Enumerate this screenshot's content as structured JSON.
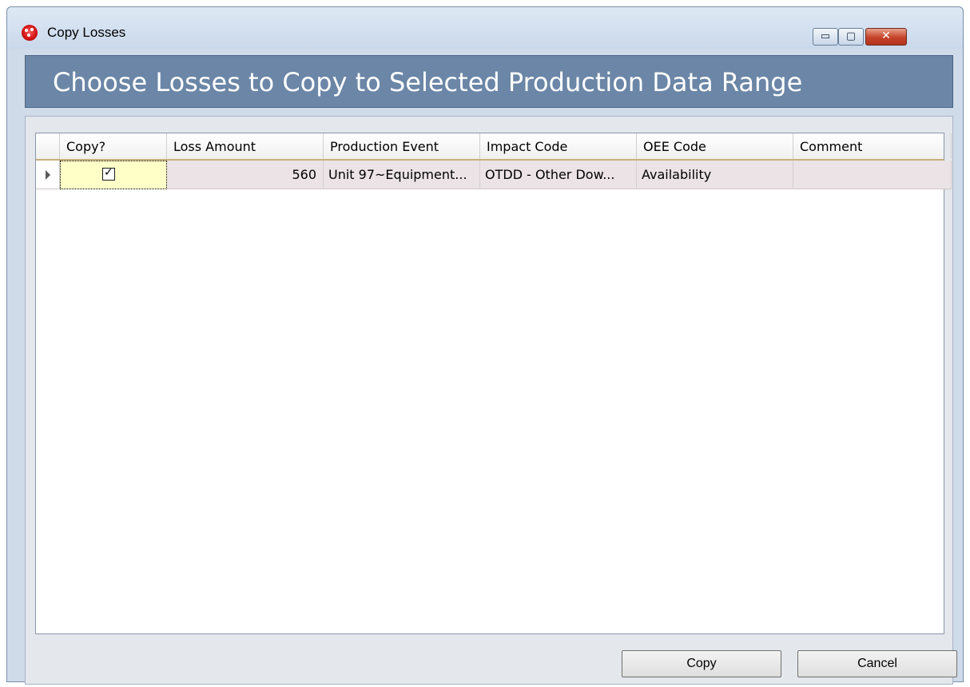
{
  "window": {
    "title": "Copy Losses",
    "controls": {
      "minimize": "▭",
      "maximize": "▢",
      "close": "✕"
    }
  },
  "header": {
    "title": "Choose Losses to Copy to Selected Production Data Range"
  },
  "grid": {
    "columns": [
      "Copy?",
      "Loss Amount",
      "Production Event",
      "Impact Code",
      "OEE Code",
      "Comment"
    ],
    "rows": [
      {
        "copy_checked": true,
        "check_glyph": "✓",
        "loss_amount": "560",
        "production_event": "Unit 97~Equipment...",
        "impact_code": "OTDD - Other Dow...",
        "oee_code": "Availability",
        "comment": ""
      }
    ]
  },
  "buttons": {
    "copy": "Copy",
    "cancel": "Cancel"
  },
  "colors": {
    "header_band": "#6b86a6",
    "selected_cell": "#ffffc8",
    "row_bg": "#ebe3e5"
  }
}
